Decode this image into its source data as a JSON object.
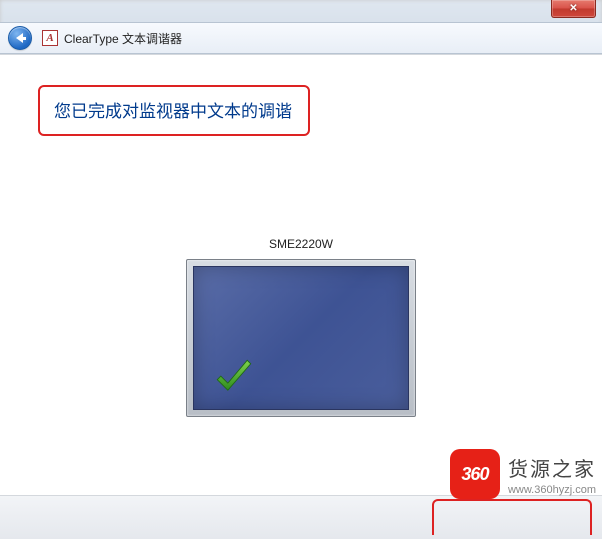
{
  "window": {
    "close_label": "✕"
  },
  "nav": {
    "app_icon_letter": "A",
    "title": "ClearType 文本调谐器"
  },
  "main": {
    "heading": "您已完成对监视器中文本的调谐",
    "monitor_name": "SME2220W"
  },
  "watermark": {
    "badge": "360",
    "brand": "货源之家",
    "url": "www.360hyzj.com"
  }
}
